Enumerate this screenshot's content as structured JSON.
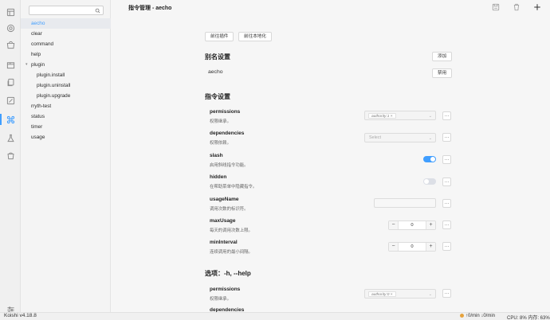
{
  "app": {
    "version": "Koishi v4.18.8"
  },
  "sidebar": {
    "search_placeholder": "",
    "items": [
      {
        "label": "aecho",
        "level": 0,
        "active": true
      },
      {
        "label": "clear",
        "level": 0
      },
      {
        "label": "command",
        "level": 0
      },
      {
        "label": "help",
        "level": 0
      },
      {
        "label": "plugin",
        "level": 0,
        "expanded": true
      },
      {
        "label": "plugin.install",
        "level": 1
      },
      {
        "label": "plugin.uninstall",
        "level": 1
      },
      {
        "label": "plugin.upgrade",
        "level": 1
      },
      {
        "label": "rryth-test",
        "level": 0
      },
      {
        "label": "status",
        "level": 0
      },
      {
        "label": "timer",
        "level": 0
      },
      {
        "label": "usage",
        "level": 0
      }
    ]
  },
  "header": {
    "title": "指令管理 - aecho"
  },
  "actions": {
    "goto_plugin": "前往插件",
    "goto_locale": "前往本地化"
  },
  "alias_section": {
    "title": "别名设置",
    "add_label": "添加",
    "alias": "aecho",
    "disable_label": "禁用"
  },
  "command_section": {
    "title": "指令设置",
    "rows": {
      "permissions": {
        "name": "permissions",
        "desc": "权限继承。",
        "tag": "authority:1"
      },
      "dependencies": {
        "name": "dependencies",
        "desc": "权限依赖。",
        "placeholder": "Select"
      },
      "slash": {
        "name": "slash",
        "desc": "启用斜线指令功能。",
        "on": true
      },
      "hidden": {
        "name": "hidden",
        "desc": "在帮助菜单中隐藏指令。",
        "on": false
      },
      "usageName": {
        "name": "usageName",
        "desc": "调用次数的标识符。",
        "placeholder": ""
      },
      "maxUsage": {
        "name": "maxUsage",
        "desc": "每天的调用次数上限。",
        "value": "0"
      },
      "minInterval": {
        "name": "minInterval",
        "desc": "连续调用的最小间隔。",
        "value": "0"
      }
    }
  },
  "option_section": {
    "title": "选项：-h, --help",
    "permissions": {
      "name": "permissions",
      "desc": "权限继承。",
      "tag": "authority:0"
    },
    "dependencies_name": "dependencies"
  },
  "statusbar": {
    "network": "↑0/min ↓0/min",
    "cpu": "CPU: 8% 内存: 63%"
  },
  "colors": {
    "accent": "#409eff",
    "warning": "#e6a23c"
  }
}
